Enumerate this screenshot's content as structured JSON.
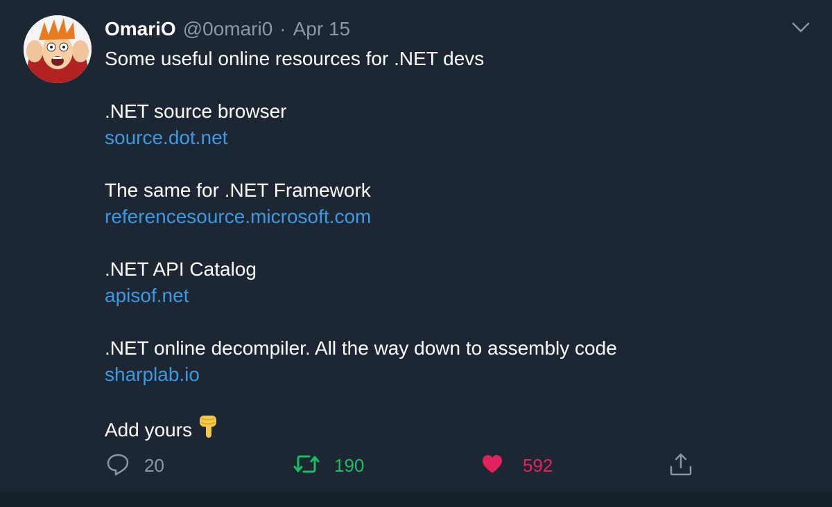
{
  "tweet": {
    "display_name": "OmariO",
    "handle": "@0omari0",
    "separator": "·",
    "date": "Apr 15",
    "lines": {
      "intro": "Some useful online resources for .NET devs",
      "item1_title": ".NET source browser",
      "item1_link": "source.dot.net",
      "item2_title": "The same for .NET Framework",
      "item2_link": "referencesource.microsoft.com",
      "item3_title": ".NET API Catalog",
      "item3_link": "apisof.net",
      "item4_title": ".NET online decompiler. All the way down to assembly code",
      "item4_link": "sharplab.io",
      "outro": "Add yours"
    },
    "emoji": "backhand-index-pointing-down",
    "actions": {
      "replies": "20",
      "retweets": "190",
      "likes": "592"
    }
  },
  "colors": {
    "background": "#1c2733",
    "text": "#ffffff",
    "muted": "#8899a6",
    "link": "#3b9ae1",
    "retweet": "#17bf63",
    "like": "#e0245e"
  },
  "icons": [
    "avatar",
    "chevron-down-icon",
    "reply-icon",
    "retweet-icon",
    "heart-icon",
    "share-icon"
  ]
}
